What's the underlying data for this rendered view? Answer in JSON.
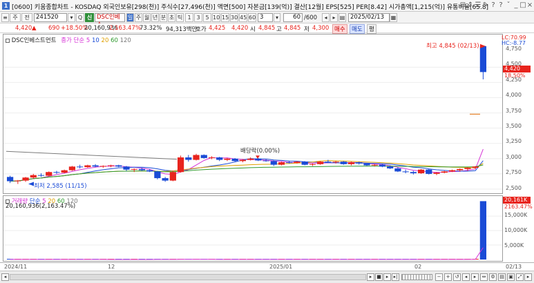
{
  "window": {
    "icon_text": "1",
    "title": "[0600] 키움종합차트 - KOSDAQ 외국인보유[298(천)] 주식수[27,496(천)] 액면[500] 자본금[139(억)] 결산[12월] EPS[525] PER[8.42] 시가총액[1,215(억)] 유통비율[65.8]",
    "controls": [
      "⊟",
      "↕",
      "☰",
      "✎",
      "?",
      "?",
      "ˇ",
      "_",
      "□",
      "×"
    ]
  },
  "toolbar": {
    "btn_main": "주",
    "btn_prev": "전",
    "code": "241520",
    "search_icon": "Q",
    "credit_badge": "신",
    "stock_name": "DSC인베스",
    "period_buttons": [
      "일",
      "주",
      "월",
      "년",
      "분",
      "초",
      "틱"
    ],
    "minute_buttons": [
      "1",
      "3",
      "5",
      "10",
      "15",
      "30",
      "45",
      "60"
    ],
    "interval_value": "3",
    "count_value": "60",
    "count_total": "/600",
    "date_value": "2025/02/13",
    "calendar_icon": "▦"
  },
  "quote": {
    "price": "4,420",
    "up_arrow": "▲",
    "change": "690",
    "change_pct": "+18.50%",
    "volume": "20,160,936",
    "volume_pct": "2,163.47%",
    "turnover": "73.32%",
    "amount": "94,313백만",
    "hoga_label": "호가",
    "hoga": "4,425",
    "hoga2": "4,420",
    "open_label": "시",
    "open": "4,845",
    "high_label": "고",
    "high": "4,845",
    "low_label": "저",
    "low": "4,300",
    "buy": "매수",
    "sell": "매도",
    "flat": "평"
  },
  "main_chart": {
    "legend_name": "DSC인베스트먼트",
    "ma_label": "종가 단순",
    "ma_periods": [
      "5",
      "10",
      "20",
      "60",
      "120"
    ],
    "annotation_high": "최고 4,845 (02/13)",
    "annotation_low": "최저 2,585 (11/15)",
    "annotation_dividend": "배당락(0.00%)",
    "lc_label": "LC:70.99",
    "hc_label": "HC:-8.77",
    "current_price_tag": "4,420",
    "current_pct_tag": "18.50%",
    "y_ticks": [
      "4,750",
      "4,500",
      "4,250",
      "4,000",
      "3,750",
      "3,500",
      "3,250",
      "3,000",
      "2,750",
      "2,500"
    ]
  },
  "volume_chart": {
    "legend_name": "거래량",
    "ma_label": "단순",
    "ma_periods": [
      "5",
      "20",
      "60",
      "120"
    ],
    "value_text": "20,160,936(2,163.47%)",
    "vol_tag": "20,161K",
    "vol_pct_tag": "2163.47%",
    "y_ticks": [
      "15,000K",
      "10,000K",
      "5,000K"
    ]
  },
  "x_axis": {
    "labels": [
      "2024/11",
      "12",
      "2025/01",
      "02"
    ],
    "right_label": "02/13"
  },
  "colors": {
    "up": "#e8241d",
    "down": "#1a4bd6",
    "ma5": "#d633d6",
    "ma10": "#1a4bd6",
    "ma20": "#e0a000",
    "ma60": "#2f9a2f",
    "ma120": "#7a7a7a"
  },
  "chart_data": {
    "type": "candlestick",
    "x_range": [
      "2024/11",
      "2025/02/13"
    ],
    "y_range": [
      2500,
      4900
    ],
    "last": {
      "date": "02/13",
      "open": 4845,
      "high": 4845,
      "low": 4300,
      "close": 4420,
      "volume": 20160936
    },
    "extremes": {
      "high": {
        "value": 4845,
        "date": "02/13"
      },
      "low": {
        "value": 2585,
        "date": "11/15"
      }
    },
    "candles": [
      [
        2700,
        2720,
        2600,
        2630
      ],
      [
        2630,
        2650,
        2585,
        2640
      ],
      [
        2640,
        2700,
        2620,
        2690
      ],
      [
        2690,
        2750,
        2670,
        2730
      ],
      [
        2730,
        2760,
        2700,
        2720
      ],
      [
        2720,
        2790,
        2710,
        2780
      ],
      [
        2780,
        2800,
        2750,
        2770
      ],
      [
        2770,
        2820,
        2760,
        2810
      ],
      [
        2810,
        2880,
        2800,
        2870
      ],
      [
        2870,
        2900,
        2840,
        2860
      ],
      [
        2860,
        2900,
        2850,
        2890
      ],
      [
        2890,
        2910,
        2860,
        2870
      ],
      [
        2870,
        2890,
        2850,
        2880
      ],
      [
        2880,
        2900,
        2860,
        2890
      ],
      [
        2890,
        2900,
        2860,
        2870
      ],
      [
        2870,
        2880,
        2800,
        2820
      ],
      [
        2820,
        2840,
        2780,
        2830
      ],
      [
        2830,
        2850,
        2800,
        2810
      ],
      [
        2810,
        2830,
        2780,
        2790
      ],
      [
        2790,
        2800,
        2660,
        2680
      ],
      [
        2680,
        2700,
        2620,
        2640
      ],
      [
        2640,
        2800,
        2630,
        2780
      ],
      [
        2780,
        3050,
        2770,
        3020
      ],
      [
        3020,
        3060,
        2950,
        2980
      ],
      [
        2980,
        3080,
        2970,
        3060
      ],
      [
        3060,
        3070,
        3000,
        3010
      ],
      [
        3010,
        3040,
        2990,
        3020
      ],
      [
        3020,
        3030,
        2960,
        2980
      ],
      [
        2980,
        3010,
        2960,
        3000
      ],
      [
        3000,
        3010,
        2950,
        2960
      ],
      [
        2960,
        2990,
        2940,
        2980
      ],
      [
        2980,
        3020,
        2970,
        3000
      ],
      [
        3000,
        3010,
        2960,
        2970
      ],
      [
        2970,
        2990,
        2950,
        2960
      ],
      [
        2960,
        2970,
        2880,
        2900
      ],
      [
        2900,
        2950,
        2890,
        2940
      ],
      [
        2940,
        2960,
        2920,
        2930
      ],
      [
        2930,
        2960,
        2920,
        2950
      ],
      [
        2950,
        2960,
        2890,
        2900
      ],
      [
        2900,
        2920,
        2880,
        2910
      ],
      [
        2910,
        2960,
        2900,
        2950
      ],
      [
        2950,
        2980,
        2930,
        2940
      ],
      [
        2940,
        2960,
        2920,
        2950
      ],
      [
        2950,
        2960,
        2900,
        2910
      ],
      [
        2910,
        2950,
        2890,
        2940
      ],
      [
        2940,
        2950,
        2900,
        2920
      ],
      [
        2920,
        2930,
        2880,
        2890
      ],
      [
        2890,
        2910,
        2870,
        2900
      ],
      [
        2900,
        2910,
        2860,
        2870
      ],
      [
        2870,
        2890,
        2830,
        2840
      ],
      [
        2840,
        2860,
        2780,
        2790
      ],
      [
        2790,
        2820,
        2760,
        2780
      ],
      [
        2780,
        2800,
        2740,
        2760
      ],
      [
        2760,
        2830,
        2750,
        2820
      ],
      [
        2820,
        2830,
        2740,
        2750
      ],
      [
        2750,
        2780,
        2730,
        2770
      ],
      [
        2770,
        2800,
        2760,
        2790
      ],
      [
        2790,
        2820,
        2780,
        2810
      ],
      [
        2810,
        2840,
        2790,
        2830
      ],
      [
        2830,
        2860,
        2800,
        2850
      ],
      [
        2850,
        2880,
        2830,
        2870
      ],
      [
        4845,
        4845,
        4300,
        4420
      ]
    ],
    "volumes_k": [
      60,
      45,
      50,
      55,
      40,
      60,
      45,
      50,
      70,
      55,
      45,
      40,
      35,
      40,
      35,
      55,
      40,
      35,
      40,
      80,
      70,
      90,
      150,
      90,
      80,
      70,
      60,
      55,
      60,
      55,
      50,
      55,
      50,
      45,
      70,
      55,
      45,
      50,
      60,
      45,
      55,
      50,
      45,
      55,
      50,
      45,
      55,
      45,
      50,
      60,
      70,
      60,
      55,
      80,
      60,
      50,
      55,
      60,
      70,
      80,
      150,
      20161
    ]
  }
}
